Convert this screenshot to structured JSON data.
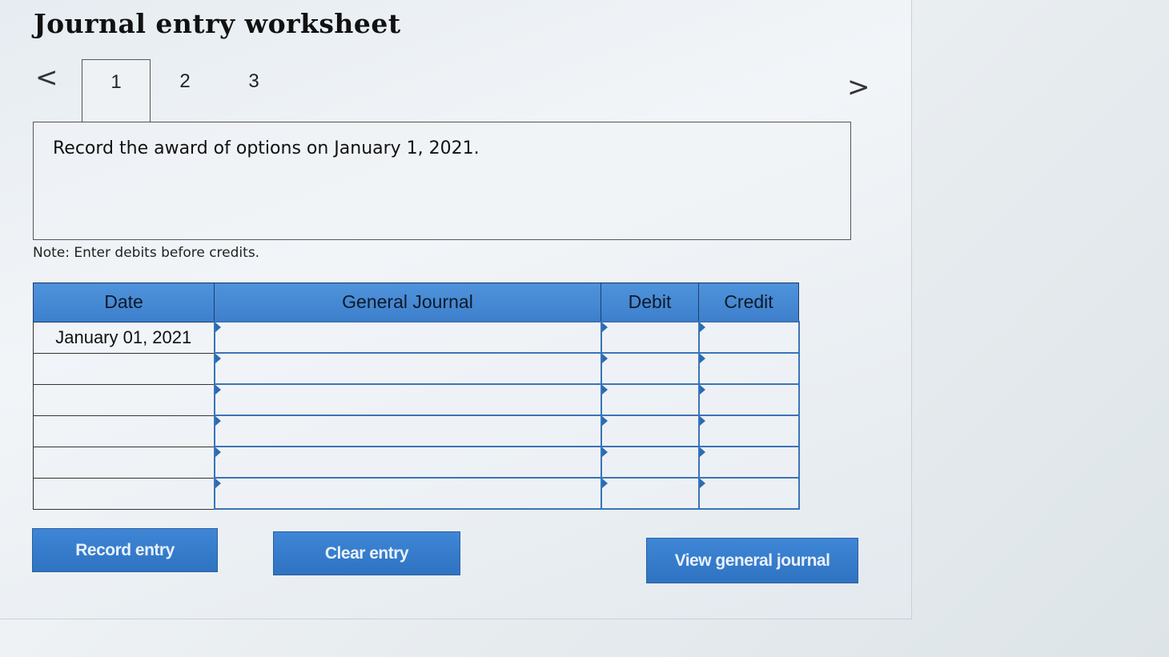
{
  "page": {
    "title": "Journal entry worksheet"
  },
  "nav": {
    "prev_icon": "chevron-left-icon",
    "next_icon": "chevron-right-icon",
    "prev_glyph": "<",
    "next_glyph": ">"
  },
  "tabs": [
    {
      "label": "1",
      "active": true
    },
    {
      "label": "2",
      "active": false
    },
    {
      "label": "3",
      "active": false
    }
  ],
  "instruction": "Record the award of options on January 1, 2021.",
  "note": "Note: Enter debits before credits.",
  "table": {
    "headers": {
      "date": "Date",
      "general_journal": "General Journal",
      "debit": "Debit",
      "credit": "Credit"
    },
    "rows": [
      {
        "date": "January 01, 2021",
        "account": "",
        "debit": "",
        "credit": ""
      },
      {
        "date": "",
        "account": "",
        "debit": "",
        "credit": ""
      },
      {
        "date": "",
        "account": "",
        "debit": "",
        "credit": ""
      },
      {
        "date": "",
        "account": "",
        "debit": "",
        "credit": ""
      },
      {
        "date": "",
        "account": "",
        "debit": "",
        "credit": ""
      },
      {
        "date": "",
        "account": "",
        "debit": "",
        "credit": ""
      }
    ]
  },
  "buttons": {
    "record": "Record entry",
    "clear": "Clear entry",
    "view": "View general journal"
  },
  "colors": {
    "header_blue": "#4f93dc",
    "button_blue": "#3a7ccb"
  }
}
